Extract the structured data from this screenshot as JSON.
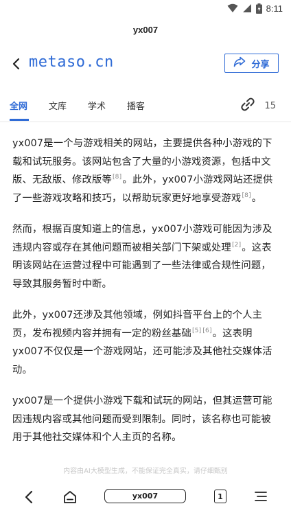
{
  "status_bar": {
    "time": "8:11"
  },
  "header": {
    "title": "yx007"
  },
  "nav": {
    "site": "metaso.cn",
    "share_label": "分享"
  },
  "tabs": [
    {
      "label": "全网",
      "active": true
    },
    {
      "label": "文库",
      "active": false
    },
    {
      "label": "学术",
      "active": false
    },
    {
      "label": "播客",
      "active": false
    }
  ],
  "sources": {
    "count": "15"
  },
  "paragraphs": [
    {
      "p1": "yx007是一个与游戏相关的网站，主要提供各种小游戏的下载和试玩服务。该网站包含了大量的小游戏资源，包括中文版、无敌版、修改版等",
      "c1": "[8]",
      "p2": "。此外，yx007小游戏网站还提供了一些游戏攻略和技巧，以帮助玩家更好地享受游戏",
      "c2": "[8]",
      "p3": "。"
    },
    {
      "p1": "然而，根据百度知道上的信息，yx007小游戏可能因为涉及违规内容或存在其他问题而被相关部门下架或处理",
      "c1": "[2]",
      "p2": "。这表明该网站在运营过程中可能遇到了一些法律或合规性问题，导致其服务暂时中断。"
    },
    {
      "p1": "此外，yx007还涉及其他领域，例如抖音平台上的个人主页，发布视频内容并拥有一定的粉丝基础",
      "c1": "[5]",
      "c2": "[6]",
      "p2": "。这表明yx007不仅仅是一个游戏网站，还可能涉及其他社交媒体活动。"
    },
    {
      "p1": "yx007是一个提供小游戏下载和试玩的网站，但其运营可能因违规内容或其他问题而受到限制。同时，该名称也可能被用于其他社交媒体和个人主页的名称。"
    }
  ],
  "disclaimer": "内容由AI大模型生成，不能保证完全真实，请仔细甄别",
  "bottom_bar": {
    "address": "yx007",
    "tab_count": "1"
  },
  "colors": {
    "accent": "#2f6bd6",
    "text": "#222222",
    "muted": "#888888"
  }
}
